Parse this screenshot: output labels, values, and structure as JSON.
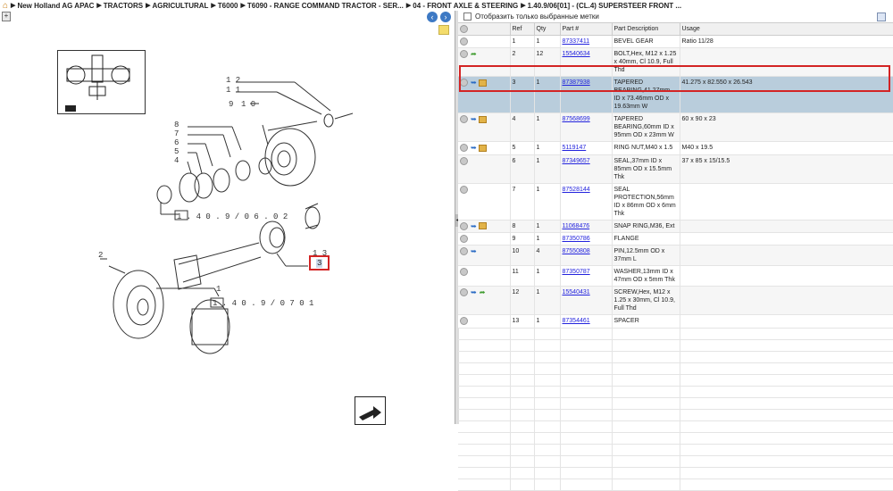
{
  "breadcrumb": {
    "items": [
      "New Holland AG APAC",
      "TRACTORS",
      "AGRICULTURAL",
      "T6000",
      "T6090 - RANGE COMMAND TRACTOR - SER...",
      "04 - FRONT AXLE & STEERING",
      "1.40.9/06[01] - (CL.4) SUPERSTEER FRONT ..."
    ]
  },
  "filter": {
    "label": "Отобразить только выбранные метки"
  },
  "table": {
    "headers": [
      "",
      "Ref",
      "Qty",
      "Part #",
      "Part Description",
      "Usage"
    ],
    "rows": [
      {
        "ref": "1",
        "qty": "1",
        "part": "87337411",
        "desc": "BEVEL GEAR",
        "usage": "Ratio 11/28",
        "icons": []
      },
      {
        "ref": "2",
        "qty": "12",
        "part": "15540634",
        "desc": "BOLT,Hex, M12 x 1.25 x 40mm, Cl 10.9, Full Thd",
        "usage": "",
        "icons": [
          "green"
        ]
      },
      {
        "ref": "3",
        "qty": "1",
        "part": "87387938",
        "desc": "TAPERED BEARING,41.27mm ID x 73.46mm OD x 19.63mm W",
        "usage": "41.275 x 82.550 x 26.543",
        "icons": [
          "blue",
          "box"
        ]
      },
      {
        "ref": "4",
        "qty": "1",
        "part": "87568699",
        "desc": "TAPERED BEARING,60mm ID x 95mm OD x 23mm W",
        "usage": "60 x 90 x 23",
        "icons": [
          "blue",
          "box"
        ]
      },
      {
        "ref": "5",
        "qty": "1",
        "part": "5119147",
        "desc": "RING NUT,M40 x 1.5",
        "usage": "M40 x 19.5",
        "icons": [
          "blue",
          "box"
        ]
      },
      {
        "ref": "6",
        "qty": "1",
        "part": "87349657",
        "desc": "SEAL,37mm ID x 85mm OD x 15.5mm Thk",
        "usage": "37 x 85 x 15/15.5",
        "icons": []
      },
      {
        "ref": "7",
        "qty": "1",
        "part": "87528144",
        "desc": "SEAL PROTECTION,56mm ID x 86mm OD x 6mm Thk",
        "usage": "",
        "icons": []
      },
      {
        "ref": "8",
        "qty": "1",
        "part": "11068476",
        "desc": "SNAP RING,M36, Ext",
        "usage": "",
        "icons": [
          "blue",
          "box"
        ]
      },
      {
        "ref": "9",
        "qty": "1",
        "part": "87350786",
        "desc": "FLANGE",
        "usage": "",
        "icons": []
      },
      {
        "ref": "10",
        "qty": "4",
        "part": "87550808",
        "desc": "PIN,12.5mm OD x 37mm L",
        "usage": "",
        "icons": [
          "blue"
        ]
      },
      {
        "ref": "11",
        "qty": "1",
        "part": "87350787",
        "desc": "WASHER,13mm ID x 47mm OD x 5mm Thk",
        "usage": "",
        "icons": []
      },
      {
        "ref": "12",
        "qty": "1",
        "part": "15540431",
        "desc": "SCREW,Hex, M12 x 1.25 x 30mm, Cl 10.9, Full Thd",
        "usage": "",
        "icons": [
          "blue",
          "green"
        ]
      },
      {
        "ref": "13",
        "qty": "1",
        "part": "87354461",
        "desc": "SPACER",
        "usage": "",
        "icons": []
      }
    ]
  },
  "diagram": {
    "labels": {
      "l12": "1 2",
      "l11": "1 1",
      "l9": "9",
      "l10": "1 0",
      "l8": "8",
      "l7": "7",
      "l6": "6",
      "l5": "5",
      "l4": "4",
      "l2": "2",
      "l1": "1",
      "l3": "3",
      "l13": "1 3",
      "ref_a": "1 . 4 0 . 9 / 0 6 . 0 2",
      "ref_b": "1 . 4 0 . 9 / 0 7   0 1"
    }
  },
  "colors": {
    "selected_row": "#b9cddc",
    "highlight": "#d32424",
    "link": "#2222dd"
  }
}
